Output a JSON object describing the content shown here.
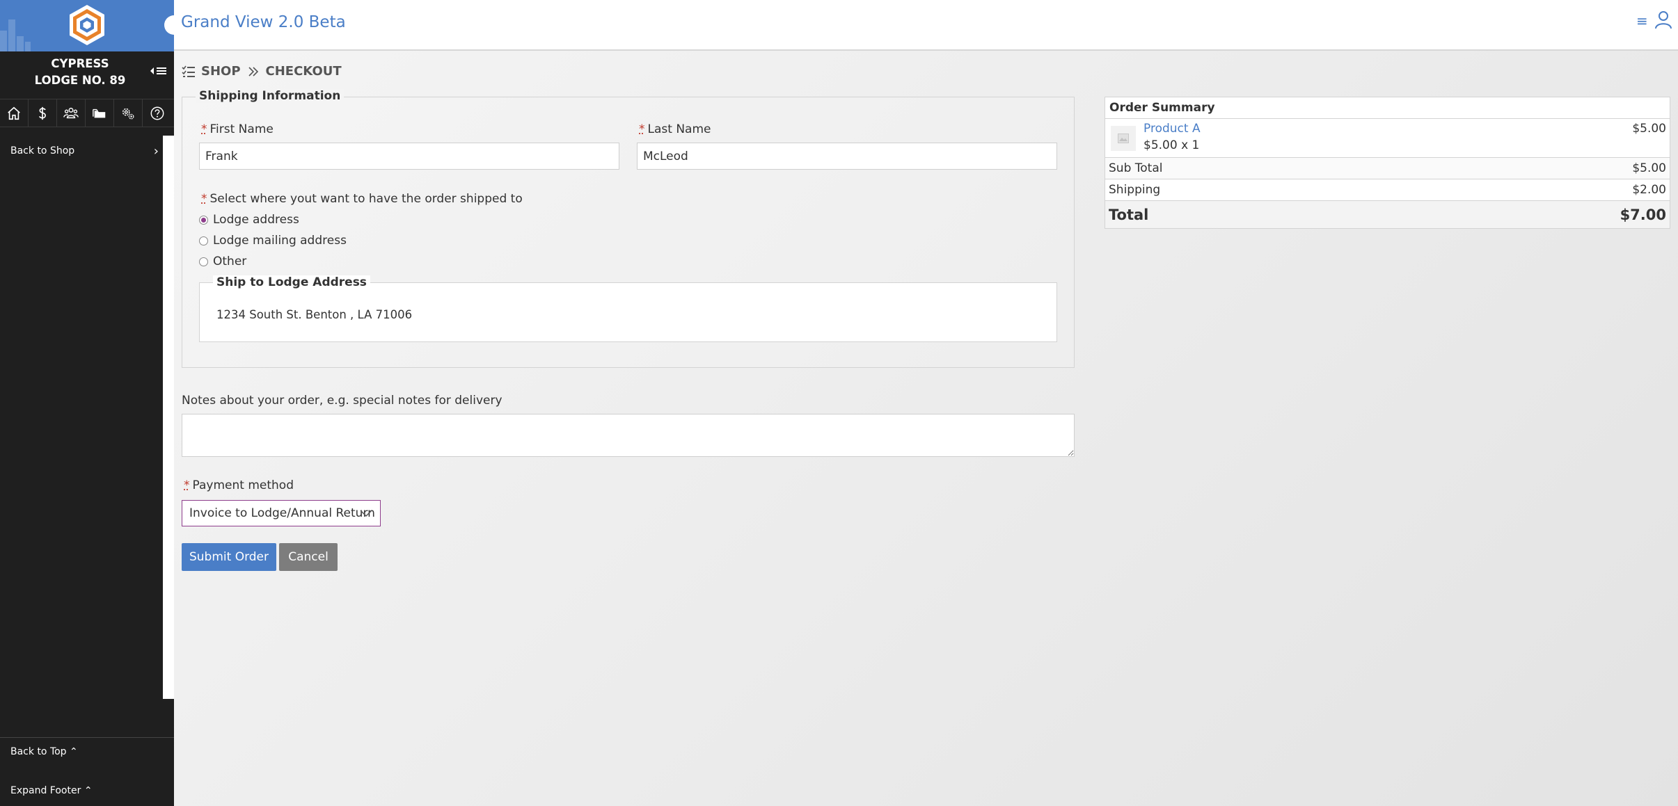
{
  "sidebar": {
    "lodge_line1": "CYPRESS",
    "lodge_line2": "LODGE NO. 89",
    "back_to_shop": "Back to Shop",
    "back_to_top": "Back to Top",
    "expand_footer": "Expand Footer",
    "nav_icons": [
      "home-icon",
      "dollar-icon",
      "users-icon",
      "folder-icon",
      "gears-icon",
      "help-icon"
    ]
  },
  "header": {
    "title": "Grand View 2.0 Beta"
  },
  "breadcrumb": {
    "shop": "SHOP",
    "checkout": "CHECKOUT"
  },
  "shipping": {
    "legend": "Shipping Information",
    "first_name_label": "First Name",
    "first_name_value": "Frank",
    "last_name_label": "Last Name",
    "last_name_value": "McLeod",
    "ship_question": "Select where yout want to have the order shipped to",
    "options": [
      "Lodge address",
      "Lodge mailing address",
      "Other"
    ],
    "selected_option": "Lodge address",
    "lodge_box_legend": "Ship to Lodge Address",
    "lodge_address": "1234 South St. Benton , LA 71006"
  },
  "notes": {
    "label": "Notes about your order, e.g. special notes for delivery",
    "value": ""
  },
  "payment": {
    "label": "Payment method",
    "selected": "Invoice to Lodge/Annual Return"
  },
  "buttons": {
    "submit": "Submit Order",
    "cancel": "Cancel"
  },
  "summary": {
    "title": "Order Summary",
    "product_name": "Product A",
    "product_qty": "$5.00 x 1",
    "product_price": "$5.00",
    "subtotal_label": "Sub Total",
    "subtotal_value": "$5.00",
    "shipping_label": "Shipping",
    "shipping_value": "$2.00",
    "total_label": "Total",
    "total_value": "$7.00"
  },
  "colors": {
    "brand_blue": "#4a7ec7",
    "sidebar_bg": "#1f1f1f",
    "radio_accent": "#8e3d8c",
    "cancel_gray": "#7d7d7d"
  }
}
